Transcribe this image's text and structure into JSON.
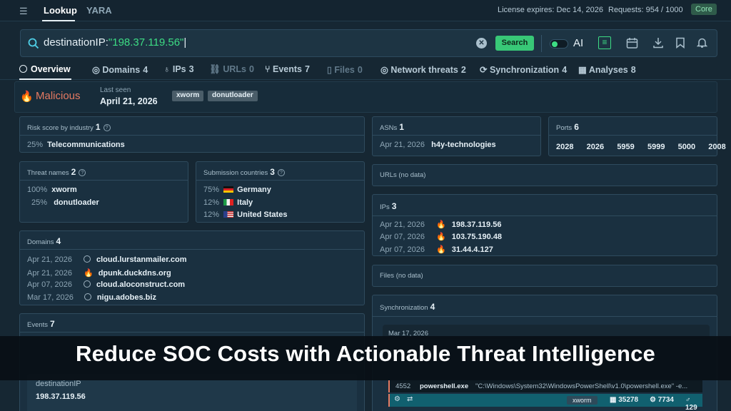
{
  "topbar": {
    "tabs": [
      "Lookup",
      "YARA"
    ],
    "license": "License expires: Dec 14, 2026",
    "requests": "Requests: 954 / 1000",
    "plan_badge": "Core"
  },
  "search": {
    "key": "destinationIP:",
    "value": "\"198.37.119.56\"",
    "button": "Search",
    "ai_label": "AI"
  },
  "nav_tabs": [
    {
      "label": "Overview",
      "count": ""
    },
    {
      "label": "Domains",
      "count": "4"
    },
    {
      "label": "IPs",
      "count": "3"
    },
    {
      "label": "URLs",
      "count": "0"
    },
    {
      "label": "Events",
      "count": "7"
    },
    {
      "label": "Files",
      "count": "0"
    },
    {
      "label": "Network threats",
      "count": "2"
    },
    {
      "label": "Synchronization",
      "count": "4"
    },
    {
      "label": "Analyses",
      "count": "8"
    }
  ],
  "summary": {
    "verdict": "Malicious",
    "last_seen_label": "Last seen",
    "last_seen": "April 21, 2026",
    "tags": [
      "xworm",
      "donutloader"
    ]
  },
  "risk": {
    "title": "Risk score by industry",
    "count": "1",
    "rows": [
      {
        "pct": "25%",
        "name": "Telecommunications"
      }
    ]
  },
  "threat_names": {
    "title": "Threat names",
    "count": "2",
    "rows": [
      {
        "pct": "100%",
        "name": "xworm"
      },
      {
        "pct": "25%",
        "name": "donutloader"
      }
    ]
  },
  "countries": {
    "title": "Submission countries",
    "count": "3",
    "rows": [
      {
        "pct": "75%",
        "name": "Germany",
        "flag": "de-flag"
      },
      {
        "pct": "12%",
        "name": "Italy",
        "flag": "it-flag"
      },
      {
        "pct": "12%",
        "name": "United States",
        "flag": "us-flag"
      }
    ]
  },
  "domains": {
    "title": "Domains",
    "count": "4",
    "rows": [
      {
        "date": "Apr 21, 2026",
        "name": "cloud.lurstanmailer.com",
        "icon": "unknown-icon"
      },
      {
        "date": "Apr 21, 2026",
        "name": "dpunk.duckdns.org",
        "icon": "fire-icon"
      },
      {
        "date": "Apr 07, 2026",
        "name": "cloud.aloconstruct.com",
        "icon": "unknown-icon"
      },
      {
        "date": "Mar 17, 2026",
        "name": "nigu.adobes.biz",
        "icon": "unknown-icon"
      }
    ]
  },
  "events": {
    "title": "Events",
    "count": "7",
    "field": "destinationIP",
    "field_value": "198.37.119.56"
  },
  "asns": {
    "title": "ASNs",
    "count": "1",
    "rows": [
      {
        "date": "Apr 21, 2026",
        "name": "h4y-technologies"
      }
    ]
  },
  "ports": {
    "title": "Ports",
    "count": "6",
    "values": [
      "2028",
      "2026",
      "5959",
      "5999",
      "5000",
      "2008"
    ]
  },
  "urls": {
    "title": "URLs (no data)"
  },
  "ips": {
    "title": "IPs",
    "count": "3",
    "rows": [
      {
        "date": "Apr 21, 2026",
        "name": "198.37.119.56"
      },
      {
        "date": "Apr 07, 2026",
        "name": "103.75.190.48"
      },
      {
        "date": "Apr 07, 2026",
        "name": "31.44.4.127"
      }
    ]
  },
  "files": {
    "title": "Files (no data)"
  },
  "sync": {
    "title": "Synchronization",
    "count": "4",
    "date": "Mar 17, 2026",
    "pid": "4552",
    "process": "powershell.exe",
    "cmd": "\"C:\\Windows\\System32\\WindowsPowerShell\\v1.0\\powershell.exe\" -e...",
    "tag": "xworm",
    "stats": [
      "35278",
      "7734",
      "129"
    ]
  },
  "banner": "Reduce SOC Costs with Actionable Threat Intelligence",
  "colors": {
    "accent": "#3ddc84",
    "malicious": "#e67a62",
    "background": "#162733"
  }
}
